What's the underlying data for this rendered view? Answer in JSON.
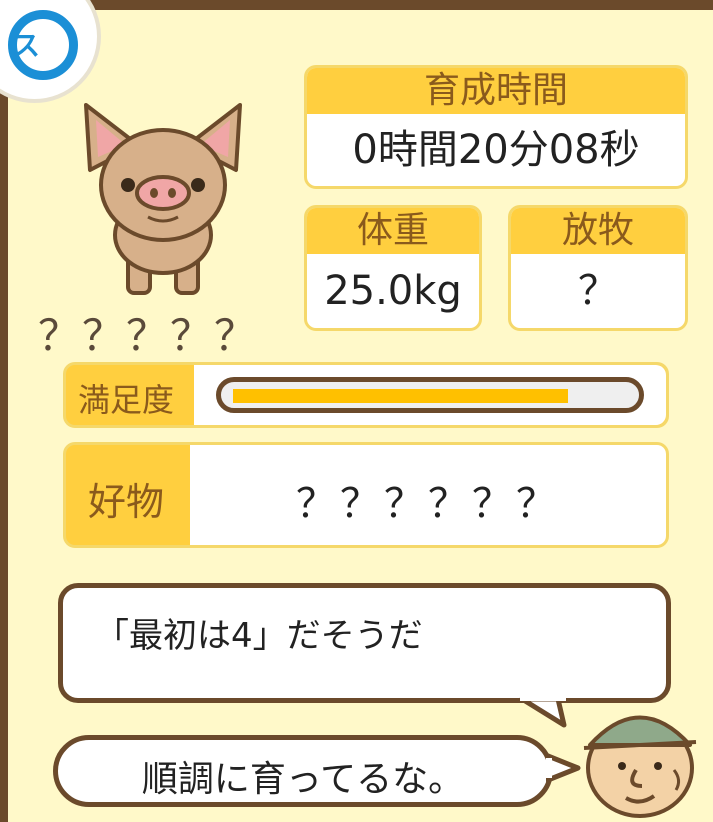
{
  "badge_text": "ス",
  "pig": {
    "name": "？？？？？"
  },
  "stats": {
    "time": {
      "label": "育成時間",
      "value": "0時間20分08秒"
    },
    "weight": {
      "label": "体重",
      "value": "25.0kg"
    },
    "grazing": {
      "label": "放牧",
      "value": "？"
    }
  },
  "satisfaction": {
    "label": "満足度",
    "level_fraction": 0.85
  },
  "favorite": {
    "label": "好物",
    "value": "？？？？？？"
  },
  "messages": {
    "hint": "「最初は4」だそうだ",
    "farmer": "順調に育ってるな。"
  },
  "colors": {
    "accent": "#ffcf3f",
    "bar_fill": "#ffc000",
    "frame": "#6b4a2b",
    "panel": "#fff9c9"
  }
}
